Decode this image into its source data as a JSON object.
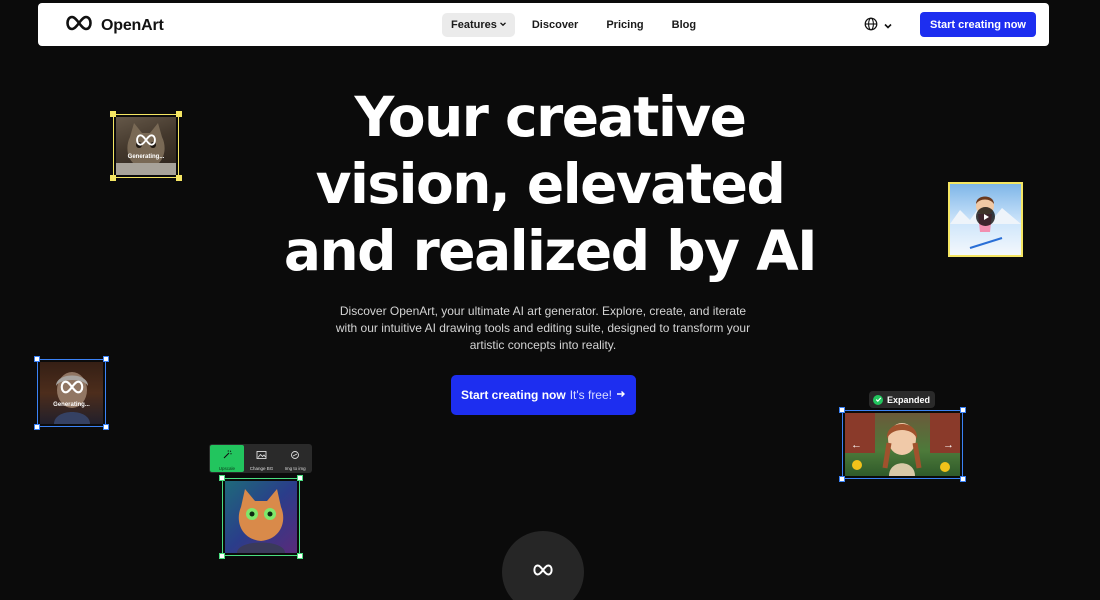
{
  "brand": {
    "name": "OpenArt",
    "logo_icon": "infinity-icon"
  },
  "nav": {
    "links": [
      "Features",
      "Discover",
      "Pricing",
      "Blog"
    ],
    "cta_label": "Start creating now",
    "language_icon": "globe-icon"
  },
  "hero": {
    "title_lines": [
      "Your creative",
      "vision, elevated",
      "and realized by AI"
    ],
    "subtitle": "Discover OpenArt, your ultimate AI art generator. Explore, create, and iterate with our intuitive AI drawing tools and editing suite, designed to transform your artistic concepts into reality.",
    "cta_strong": "Start creating now",
    "cta_light": "It's free!"
  },
  "cards": {
    "generating_label": "Generating...",
    "expanded_label": "Expanded",
    "toolbar": [
      "Upscale",
      "Change BG",
      "Img to img"
    ]
  },
  "colors": {
    "accent": "#1d2ef0",
    "frame_yellow": "#f5e663",
    "frame_blue": "#3b82f6",
    "frame_green": "#4ade80"
  }
}
